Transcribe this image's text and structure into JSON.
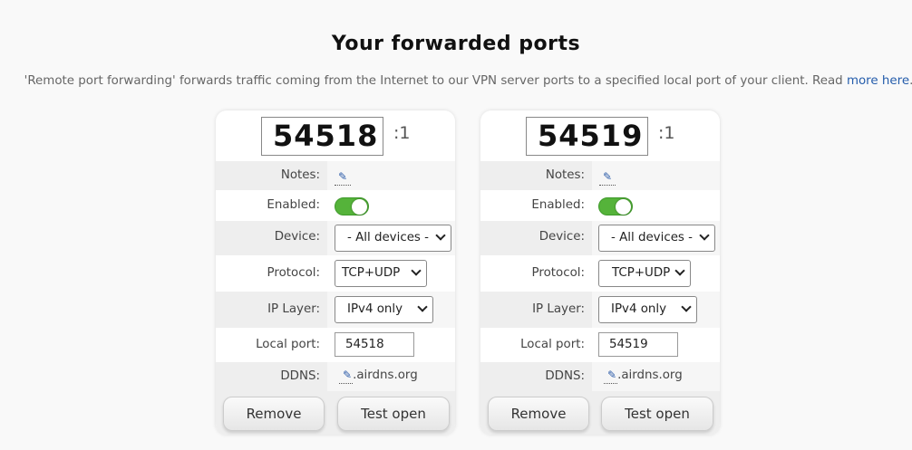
{
  "page": {
    "title": "Your forwarded ports",
    "subtitle_text": "'Remote port forwarding' forwards traffic coming from the Internet to our VPN server ports to a specified local port of your client. Read ",
    "subtitle_link": "more here",
    "subtitle_end": "."
  },
  "labels": {
    "notes": "Notes:",
    "enabled": "Enabled:",
    "device": "Device:",
    "protocol": "Protocol:",
    "ip_layer": "IP Layer:",
    "local_port": "Local port:",
    "ddns": "DDNS:",
    "remove": "Remove",
    "test_open": "Test open"
  },
  "icons": {
    "edit": "pencil-icon",
    "chevron": "chevron-down-icon"
  },
  "colors": {
    "toggle_on": "#55b33a",
    "link": "#245cab"
  },
  "ports": [
    {
      "port": "54518",
      "suffix": ":1",
      "notes_icon": "✎",
      "enabled": true,
      "device": "- All devices -",
      "protocol": "TCP+UDP",
      "ip_layer": "IPv4 only",
      "local_port": "54518",
      "ddns_icon": "✎",
      "ddns_domain": ".airdns.org"
    },
    {
      "port": "54519",
      "suffix": ":1",
      "notes_icon": "✎",
      "enabled": true,
      "device": "- All devices -",
      "protocol": "TCP+UDP",
      "ip_layer": "IPv4 only",
      "local_port": "54519",
      "ddns_icon": "✎",
      "ddns_domain": ".airdns.org"
    }
  ]
}
